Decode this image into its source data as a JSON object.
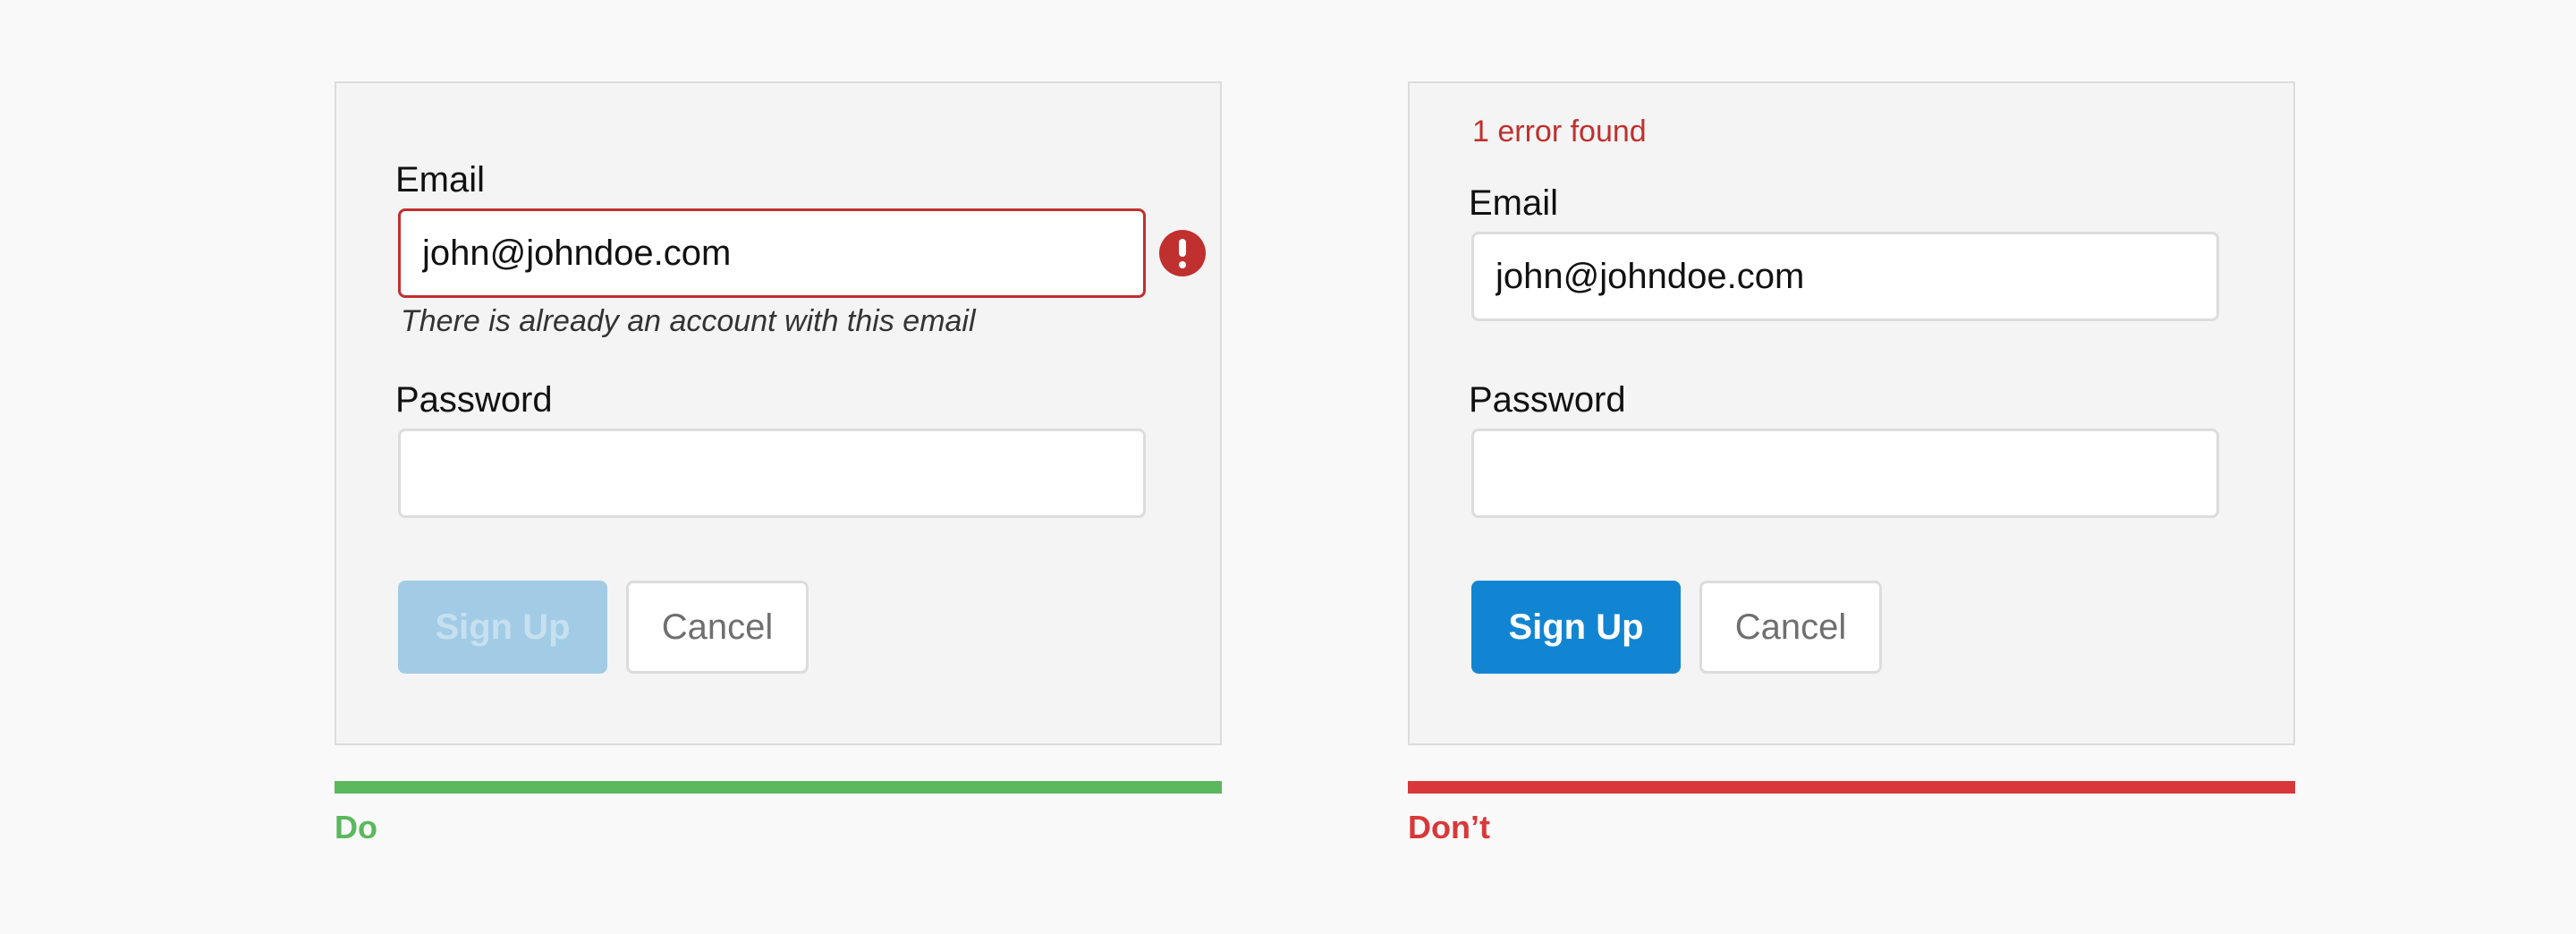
{
  "examples": {
    "do": {
      "form": {
        "email_label": "Email",
        "email_value": "john@johndoe.com",
        "email_error": "There is already an account with this email",
        "password_label": "Password",
        "password_value": "",
        "signup_label": "Sign Up",
        "signup_state": "disabled",
        "cancel_label": "Cancel"
      },
      "verdict_label": "Do",
      "verdict_color": "#5cb85c"
    },
    "dont": {
      "form": {
        "error_summary": "1 error found",
        "email_label": "Email",
        "email_value": "john@johndoe.com",
        "password_label": "Password",
        "password_value": "",
        "signup_label": "Sign Up",
        "signup_state": "enabled",
        "cancel_label": "Cancel"
      },
      "verdict_label": "Don’t",
      "verdict_color": "#d9383a"
    }
  },
  "colors": {
    "error": "#c0302e",
    "primary": "#1285d2",
    "primary_disabled": "#a2cbe6",
    "field_border": "#dcdcdc",
    "panel_background": "#f4f4f4"
  },
  "icons": {
    "email_error": "exclamation-circle-icon"
  }
}
